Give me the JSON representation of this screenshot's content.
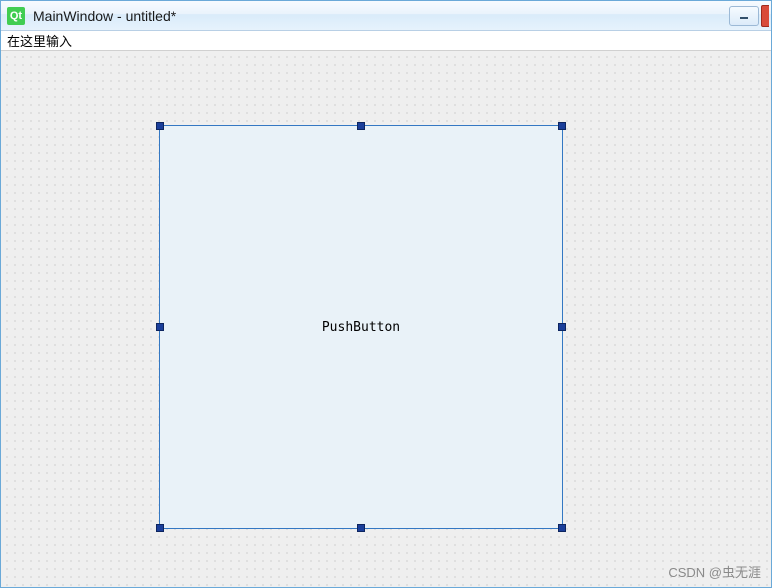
{
  "window": {
    "icon_text": "Qt",
    "title": "MainWindow - untitled*"
  },
  "menubar": {
    "placeholder_item": "在这里输入"
  },
  "designer": {
    "widget_label": "PushButton"
  },
  "watermark": "CSDN @虫无涯"
}
